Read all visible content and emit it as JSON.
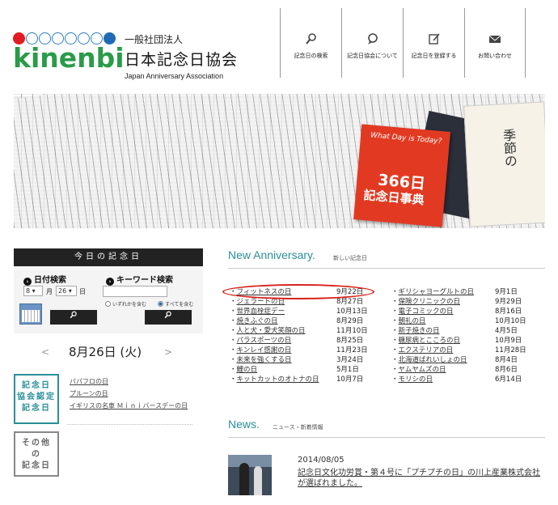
{
  "header": {
    "logo_text": "kinenbi",
    "org_small": "一般社団法人",
    "org_name": "日本記念日協会",
    "org_en": "Japan Anniversary Association",
    "nav": [
      {
        "label": "記念日の検索",
        "icon": "search-icon"
      },
      {
        "label": "記念日協会について",
        "icon": "chat-bubble-icon"
      },
      {
        "label": "記念日を登録する",
        "icon": "edit-icon"
      },
      {
        "label": "お問い合わせ",
        "icon": "mail-icon"
      }
    ]
  },
  "banner": {
    "book_subtitle": "What Day is Today?",
    "book_title": "366日",
    "book_title2": "記念日事典",
    "side_book": "季節の"
  },
  "today": {
    "heading": "今日の記念日",
    "date_search": "日付検索",
    "keyword_search": "キーワード検索",
    "month": "8",
    "month_unit": "月",
    "day": "26",
    "day_unit": "日",
    "radio_any": "いずれかを含む",
    "radio_all": "すべてを含む",
    "calendar_label": "SEPTEMBER",
    "prev": "<",
    "current_date": "8月26日 (火)",
    "next": ">"
  },
  "categories": {
    "certified": [
      "記念日",
      "協会認定",
      "記念日"
    ],
    "other": [
      "その他",
      "の",
      "記念日"
    ],
    "items": [
      "パパフロの日",
      "プルーンの日",
      "イギリスの名車 Ｍｉｎｉバースデーの日"
    ]
  },
  "anniversary": {
    "title": "New Anniversary.",
    "subtitle": "新しい記念日",
    "left": [
      {
        "name": "フィットネスの日",
        "date": "9月22日"
      },
      {
        "name": "ジェラートの日",
        "date": "8月27日"
      },
      {
        "name": "世界血栓症デー",
        "date": "10月13日"
      },
      {
        "name": "焼きふぐの日",
        "date": "8月29日"
      },
      {
        "name": "人と犬・愛犬笑顔の日",
        "date": "11月10日"
      },
      {
        "name": "パラスポーツの日",
        "date": "8月25日"
      },
      {
        "name": "キンレイ感謝の日",
        "date": "11月23日"
      },
      {
        "name": "未来を強くする日",
        "date": "3月24日"
      },
      {
        "name": "鯉の日",
        "date": "5月1日"
      },
      {
        "name": "キットカットのオトナの日",
        "date": "10月7日"
      }
    ],
    "right": [
      {
        "name": "ギリシャヨーグルトの日",
        "date": "9月1日"
      },
      {
        "name": "保険クリニックの日",
        "date": "9月29日"
      },
      {
        "name": "電子コミックの日",
        "date": "8月16日"
      },
      {
        "name": "朝礼の日",
        "date": "10月10日"
      },
      {
        "name": "新子焼きの日",
        "date": "4月5日"
      },
      {
        "name": "糖尿病とこころの日",
        "date": "10月9日"
      },
      {
        "name": "エクステリアの日",
        "date": "11月28日"
      },
      {
        "name": "北海道ばれいしょの日",
        "date": "8月4日"
      },
      {
        "name": "ヤムヤムズの日",
        "date": "8月6日"
      },
      {
        "name": "モリシの日",
        "date": "6月14日"
      }
    ]
  },
  "news": {
    "title": "News.",
    "subtitle": "ニュース・新着情報",
    "date": "2014/08/05",
    "text": "記念日文化功労賞・第４号に「プチプチの日」の川上産業株式会社が選ばれました。"
  },
  "colors": {
    "accent": "#2a8f99",
    "highlight": "#d8231d",
    "logo_green": "#2a9b49"
  }
}
